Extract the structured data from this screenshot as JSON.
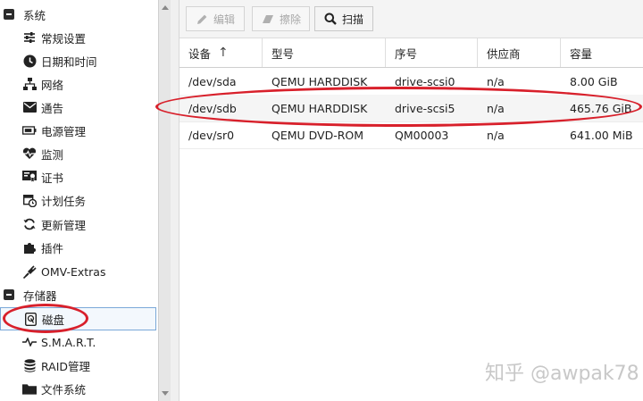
{
  "sidebar": {
    "group_system": "系统",
    "items_system": [
      {
        "label": "常规设置",
        "icon": "sliders-icon"
      },
      {
        "label": "日期和时间",
        "icon": "clock-icon"
      },
      {
        "label": "网络",
        "icon": "network-icon"
      },
      {
        "label": "通告",
        "icon": "envelope-icon"
      },
      {
        "label": "电源管理",
        "icon": "battery-icon"
      },
      {
        "label": "监测",
        "icon": "heartbeat-icon"
      },
      {
        "label": "证书",
        "icon": "certificate-icon"
      },
      {
        "label": "计划任务",
        "icon": "calendar-clock-icon"
      },
      {
        "label": "更新管理",
        "icon": "refresh-icon"
      },
      {
        "label": "插件",
        "icon": "puzzle-icon"
      },
      {
        "label": "OMV-Extras",
        "icon": "plug-icon"
      }
    ],
    "group_storage": "存储器",
    "items_storage": [
      {
        "label": "磁盘",
        "icon": "hard-disk-icon",
        "selected": true
      },
      {
        "label": "S.M.A.R.T.",
        "icon": "pulse-icon"
      },
      {
        "label": "RAID管理",
        "icon": "database-icon"
      },
      {
        "label": "文件系统",
        "icon": "folder-icon"
      }
    ]
  },
  "toolbar": {
    "edit": "编辑",
    "wipe": "擦除",
    "scan": "扫描"
  },
  "table": {
    "columns": [
      "设备",
      "型号",
      "序号",
      "供应商",
      "容量"
    ],
    "sort_indicator": "↑",
    "rows": [
      [
        "/dev/sda",
        "QEMU HARDDISK",
        "drive-scsi0",
        "n/a",
        "8.00 GiB"
      ],
      [
        "/dev/sdb",
        "QEMU HARDDISK",
        "drive-scsi5",
        "n/a",
        "465.76 GiB"
      ],
      [
        "/dev/sr0",
        "QEMU DVD-ROM",
        "QM00003",
        "n/a",
        "641.00 MiB"
      ]
    ]
  },
  "watermark": "知乎 @awpak78",
  "colors": {
    "annotation_red": "#d8202b",
    "selection_border": "#7aa8d8"
  }
}
